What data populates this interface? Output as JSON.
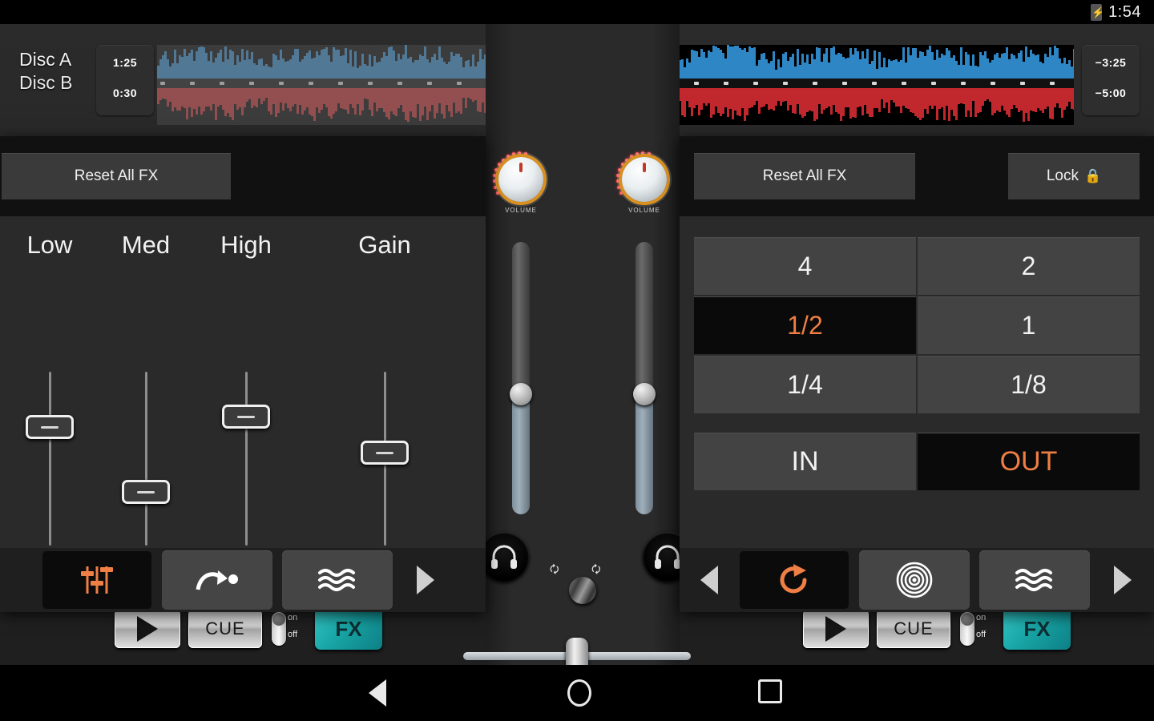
{
  "statusbar": {
    "clock": "1:54",
    "battery_icon": "battery-charging-icon",
    "bolt": "⚡"
  },
  "decks": {
    "labels": [
      "Disc A",
      "Disc B"
    ],
    "elapsed": {
      "a": "1:25",
      "b": "0:30"
    },
    "remaining": {
      "a": "−3:25",
      "b": "−5:00"
    },
    "waveform": {
      "top_color": "#2f86c5",
      "bottom_color": "#c0282d",
      "played_overlay": "#6d6d6d",
      "playhead_color": "#ff1a1a",
      "playhead_pct": 49.7,
      "beat_marker_color": "#d8d8d8"
    }
  },
  "mixer": {
    "knob_label": "VOLUME",
    "knob_accent": "#d9901f",
    "knob_indicator": "#c0392b",
    "led_color": "#ff5a5a",
    "channel_a_fader_pct": 44,
    "channel_b_fader_pct": 44,
    "crossfader_pct": 50,
    "cue_icon": "headphones-icon",
    "sync_icon_left": "sync-loop-icon",
    "sync_icon_right": "sync-loop-icon",
    "rotary_name": "browse-rotary-knob"
  },
  "transport": {
    "play_label": "",
    "play_icon": "play-icon",
    "cue_label": "CUE",
    "fx_label": "FX",
    "fx_color": "#19a6a6",
    "toggle_on_label": "on",
    "toggle_off_label": "off"
  },
  "fx_panel_left": {
    "reset_label": "Reset All FX",
    "eq": [
      {
        "label": "Low",
        "value_pct": 71
      },
      {
        "label": "Med",
        "value_pct": 28
      },
      {
        "label": "High",
        "value_pct": 78
      },
      {
        "label": "Gain",
        "value_pct": 54
      }
    ],
    "effects": [
      {
        "name": "eq-faders-icon",
        "active": true
      },
      {
        "name": "gate-arrow-icon",
        "active": false
      },
      {
        "name": "flanger-waves-icon",
        "active": false
      }
    ],
    "next_icon": "chevron-right-icon",
    "active_color": "#ef7f45"
  },
  "fx_panel_right": {
    "reset_label": "Reset All FX",
    "lock_label": "Lock",
    "lock_icon": "lock-icon",
    "loop_rows": [
      [
        {
          "label": "4",
          "active": false
        },
        {
          "label": "2",
          "active": false
        }
      ],
      [
        {
          "label": "1/2",
          "active": true
        },
        {
          "label": "1",
          "active": false
        }
      ],
      [
        {
          "label": "1/4",
          "active": false
        },
        {
          "label": "1/8",
          "active": false
        }
      ]
    ],
    "inout": [
      {
        "label": "IN",
        "active": false
      },
      {
        "label": "OUT",
        "active": true
      }
    ],
    "prev_icon": "chevron-left-icon",
    "next_icon": "chevron-right-icon",
    "effects": [
      {
        "name": "loop-roll-icon",
        "active": true
      },
      {
        "name": "phaser-rings-icon",
        "active": false
      },
      {
        "name": "flanger-waves-icon",
        "active": false
      }
    ],
    "active_color": "#ef7f45"
  },
  "navbar": {
    "back": "back-icon",
    "home": "home-icon",
    "recent": "recent-apps-icon"
  }
}
